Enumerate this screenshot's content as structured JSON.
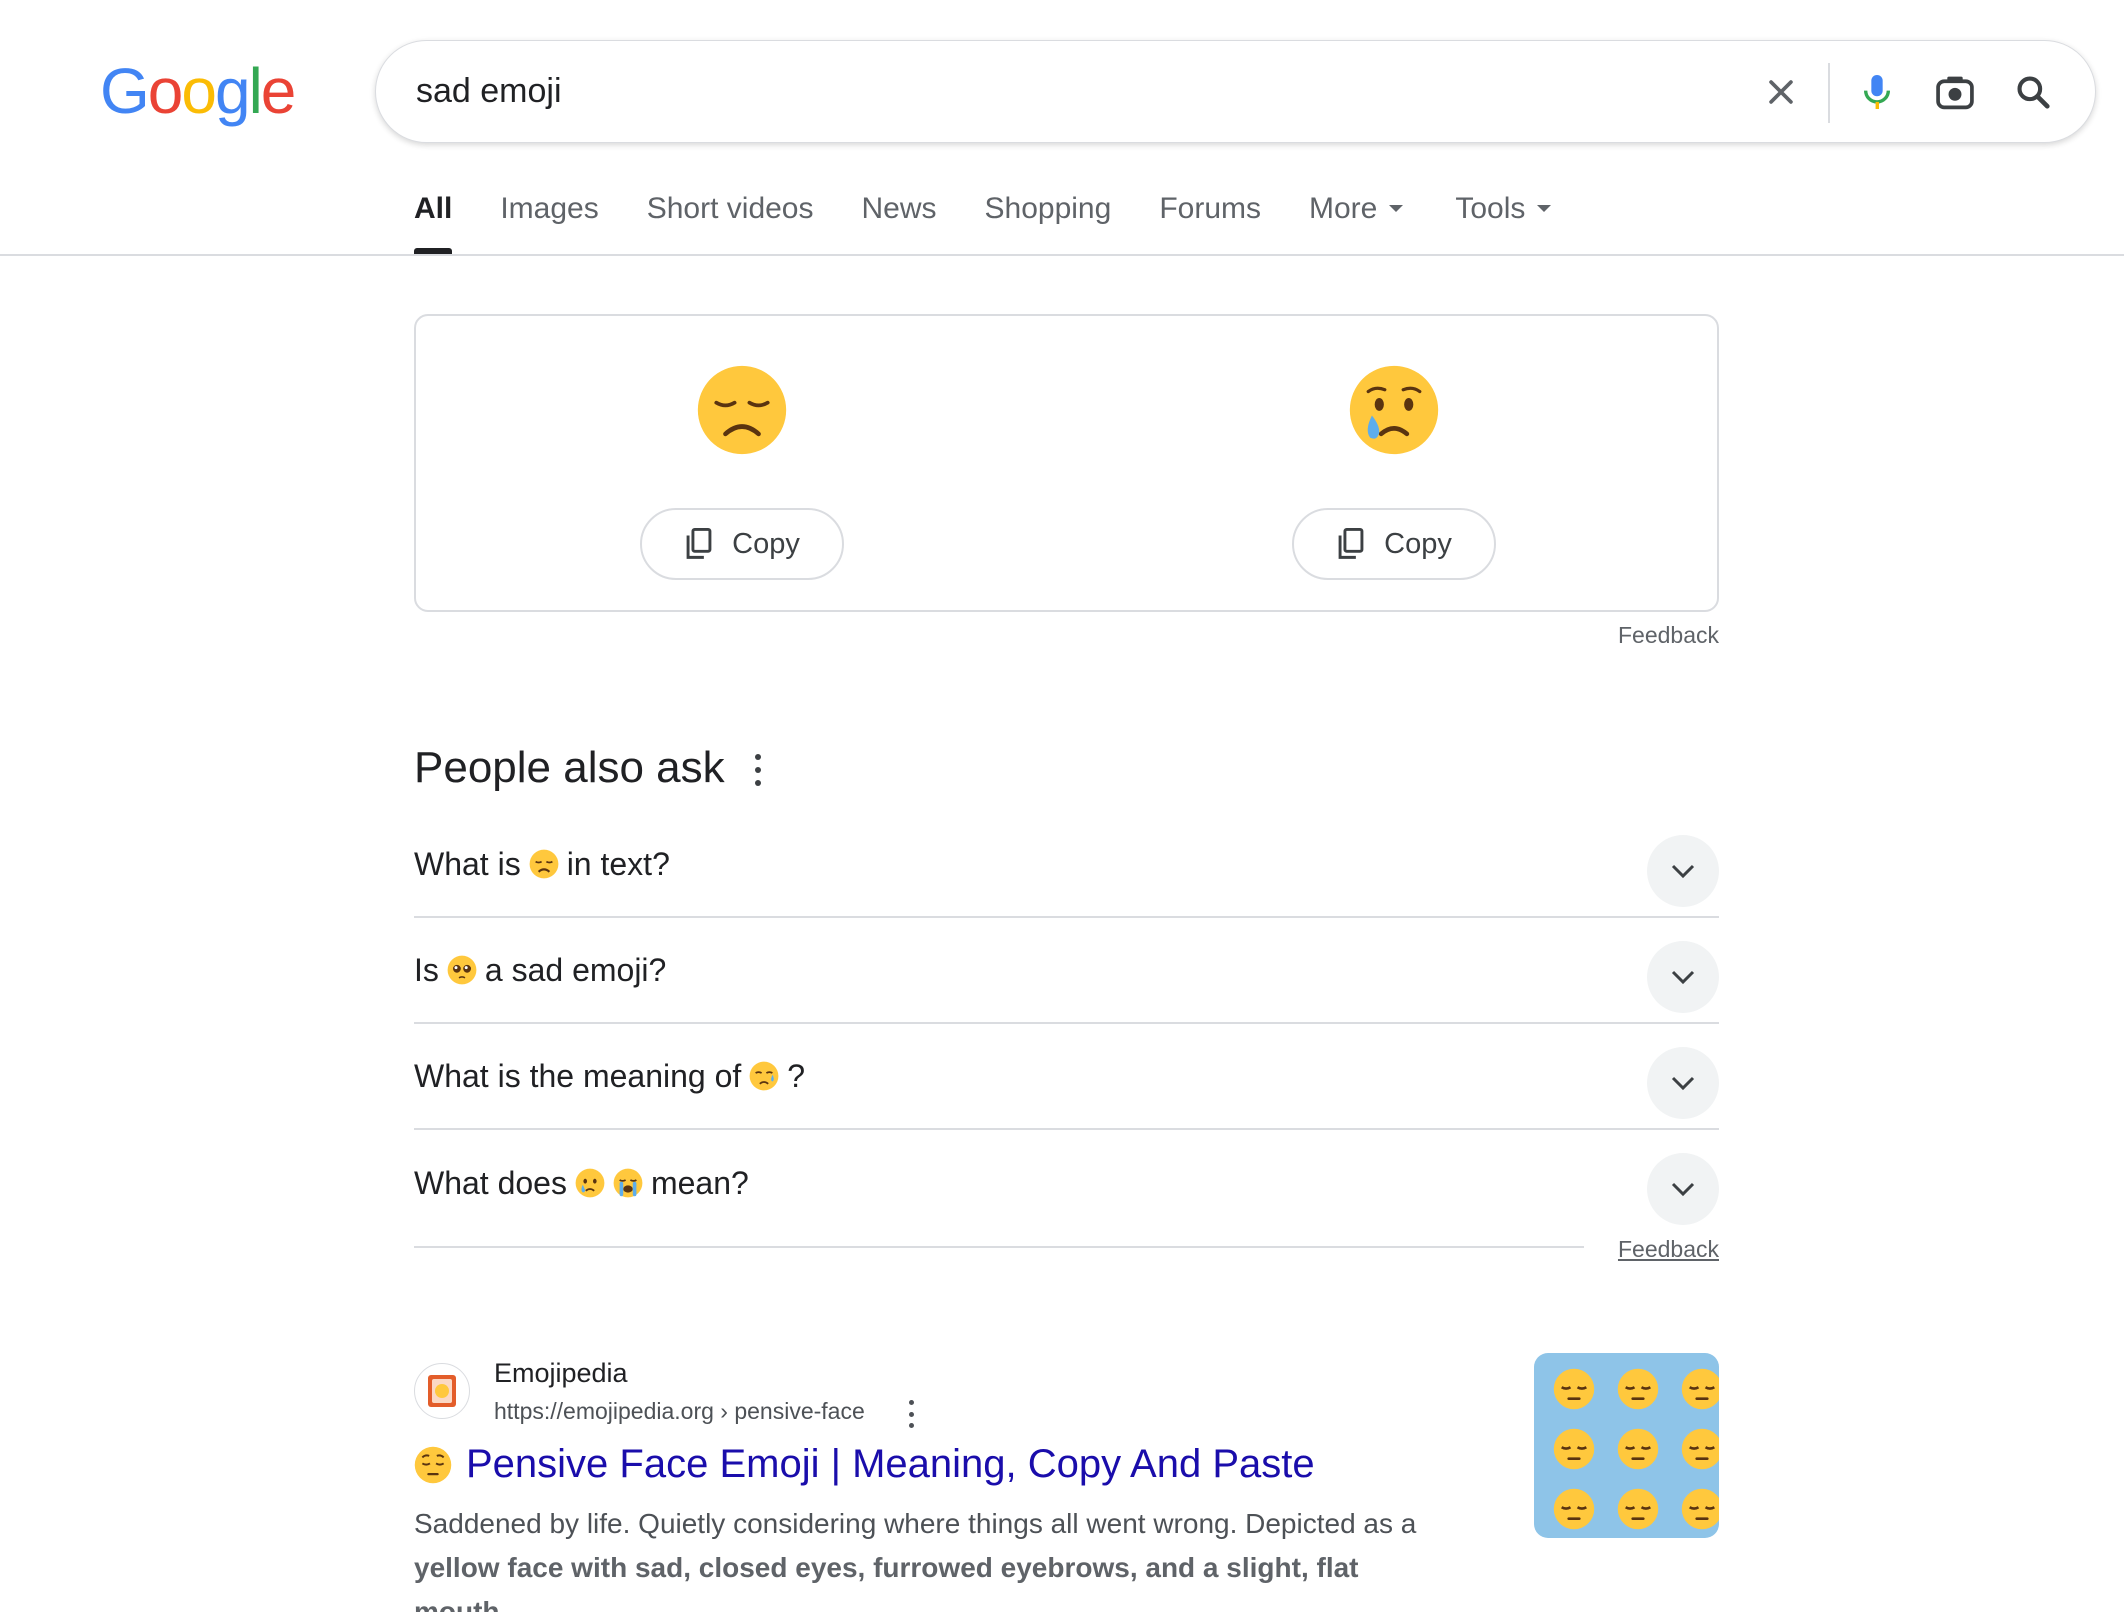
{
  "header": {
    "logo_letters": [
      {
        "char": "G",
        "color": "#4285F4"
      },
      {
        "char": "o",
        "color": "#EA4335"
      },
      {
        "char": "o",
        "color": "#FBBC05"
      },
      {
        "char": "g",
        "color": "#4285F4"
      },
      {
        "char": "l",
        "color": "#34A853"
      },
      {
        "char": "e",
        "color": "#EA4335"
      }
    ],
    "search_query": "sad emoji",
    "icons": [
      "close-icon",
      "mic-icon",
      "lens-icon",
      "search-icon"
    ]
  },
  "tabs": [
    {
      "label": "All",
      "active": true
    },
    {
      "label": "Images"
    },
    {
      "label": "Short videos"
    },
    {
      "label": "News"
    },
    {
      "label": "Shopping"
    },
    {
      "label": "Forums"
    },
    {
      "label": "More",
      "dropdown": true
    },
    {
      "label": "Tools",
      "dropdown": true
    }
  ],
  "emoji_card": {
    "items": [
      {
        "emoji": "disappointed-face",
        "copy_label": "Copy"
      },
      {
        "emoji": "crying-face",
        "copy_label": "Copy"
      }
    ],
    "feedback": "Feedback"
  },
  "people_also_ask": {
    "title": "People also ask",
    "questions": [
      {
        "before": "What is",
        "emojis": [
          "disappointed-face"
        ],
        "after": "in text?"
      },
      {
        "before": "Is",
        "emojis": [
          "pleading-face"
        ],
        "after": "a sad emoji?"
      },
      {
        "before": "What is the meaning of",
        "emojis": [
          "sad-but-relieved-face"
        ],
        "after": "?"
      },
      {
        "before": "What does",
        "emojis": [
          "crying-face",
          "loudly-crying-face"
        ],
        "after": "mean?"
      }
    ],
    "feedback": "Feedback"
  },
  "result": {
    "site_name": "Emojipedia",
    "url": "https://emojipedia.org › pensive-face",
    "title": "Pensive Face Emoji | Meaning, Copy And Paste",
    "title_emoji": "pensive-face",
    "snippet_plain": "Saddened by life. Quietly considering where things all went wrong. Depicted as a ",
    "snippet_bold": "yellow face with sad, closed eyes, furrowed eyebrows, and a slight, flat mouth",
    "snippet_end": "."
  },
  "colors": {
    "accent_blue": "#1a0dab",
    "border": "#dadce0",
    "emoji_yellow": "#FFC83D",
    "tear_blue": "#5DADEC"
  }
}
